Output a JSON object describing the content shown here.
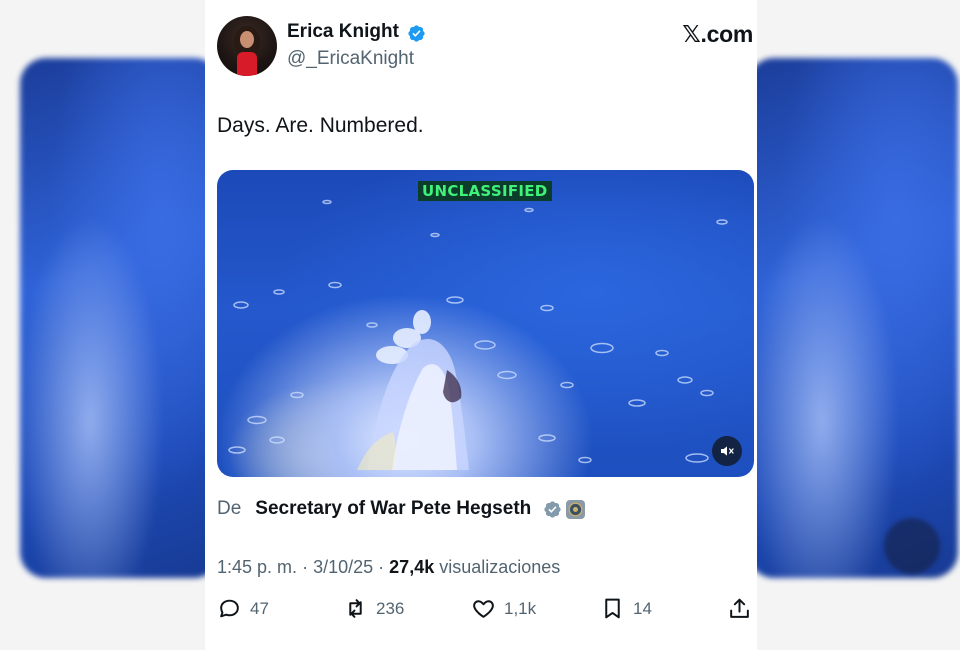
{
  "author": {
    "name": "Erica Knight",
    "handle": "@_EricaKnight",
    "verified_color": "#1d9bf0"
  },
  "brand": "𝕏.com",
  "tweet": {
    "text": "Days. Are. Numbered."
  },
  "media": {
    "overlay_label": "UNCLASSIFIED",
    "overlay_label_color": "#3ff27a",
    "mute_icon": "speaker-muted-icon"
  },
  "source": {
    "prefix": "De",
    "name": "Secretary of War Pete Hegseth"
  },
  "meta": {
    "time": "1:45 p. m.",
    "separator": "·",
    "date": "3/10/25",
    "views_count": "27,4k",
    "views_label": "visualizaciones"
  },
  "actions": {
    "replies": "47",
    "reposts": "236",
    "likes": "1,1k",
    "bookmarks": "14"
  },
  "colors": {
    "text_primary": "#0f1419",
    "text_secondary": "#536471",
    "verified_blue": "#1d9bf0"
  }
}
